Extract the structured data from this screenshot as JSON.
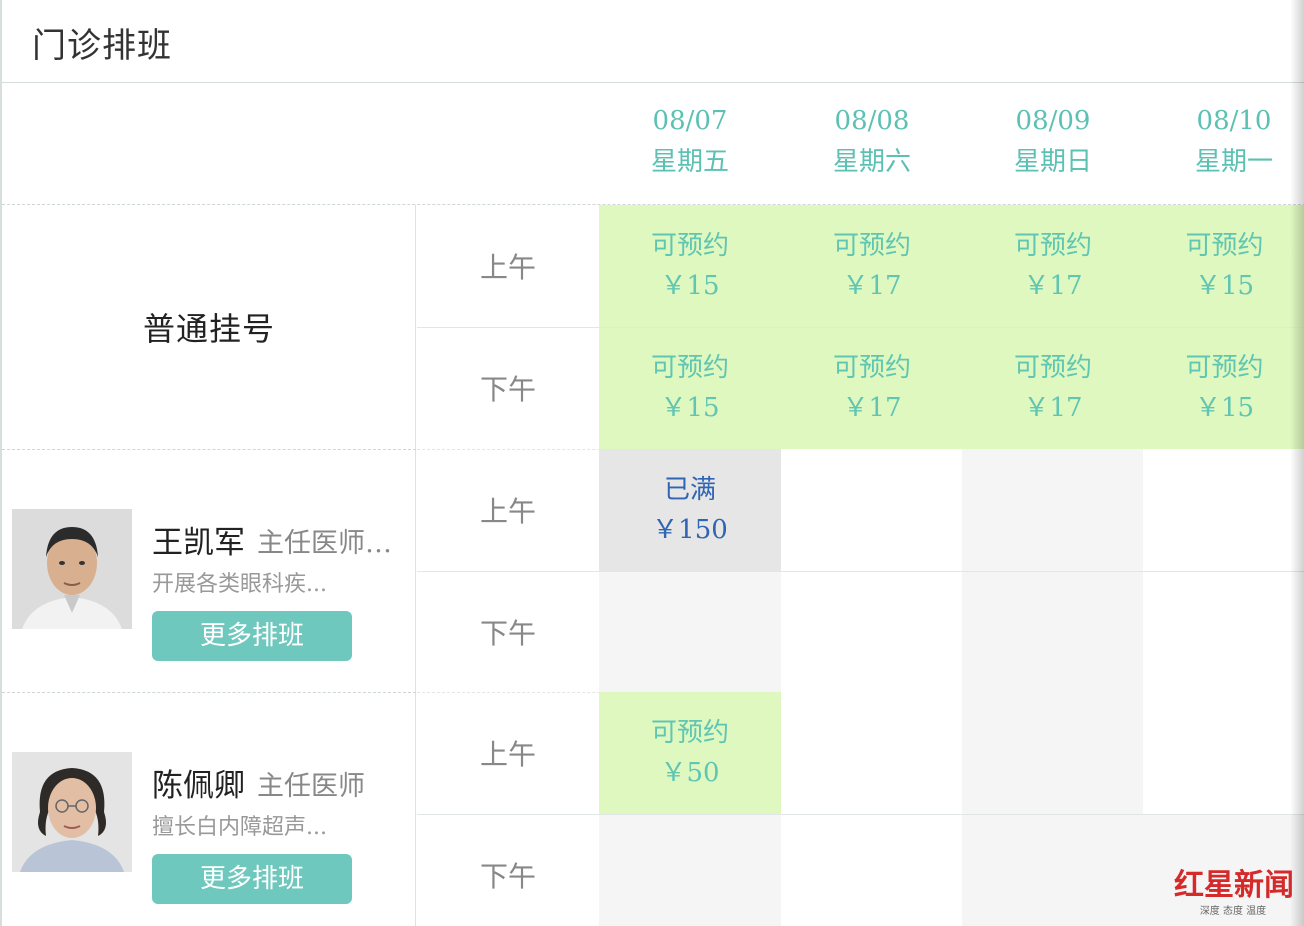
{
  "page": {
    "title": "门诊排班"
  },
  "dates": [
    {
      "date": "08/07",
      "weekday": "星期五"
    },
    {
      "date": "08/08",
      "weekday": "星期六"
    },
    {
      "date": "08/09",
      "weekday": "星期日"
    },
    {
      "date": "08/10",
      "weekday": "星期一"
    }
  ],
  "periods": {
    "am": "上午",
    "pm": "下午"
  },
  "general": {
    "label": "普通挂号",
    "am": [
      {
        "status": "可预约",
        "price": "￥15"
      },
      {
        "status": "可预约",
        "price": "￥17"
      },
      {
        "status": "可预约",
        "price": "￥17"
      },
      {
        "status": "可预约",
        "price": "￥15"
      }
    ],
    "pm": [
      {
        "status": "可预约",
        "price": "￥15"
      },
      {
        "status": "可预约",
        "price": "￥17"
      },
      {
        "status": "可预约",
        "price": "￥17"
      },
      {
        "status": "可预约",
        "price": "￥15"
      }
    ]
  },
  "doctors": [
    {
      "name": "王凯军",
      "title": "主任医师…",
      "desc": "开展各类眼科疾...",
      "button": "更多排班",
      "am": [
        {
          "status": "已满",
          "price": "￥150"
        }
      ]
    },
    {
      "name": "陈佩卿",
      "title": "主任医师",
      "desc": "擅长白内障超声...",
      "button": "更多排班",
      "am": [
        {
          "status": "可预约",
          "price": "￥50"
        }
      ]
    }
  ],
  "watermark": {
    "main": "红星新闻",
    "sub": "深度 态度 温度"
  },
  "colors": {
    "accent": "#5cc1b3",
    "available_bg": "#dff8c0",
    "full_bg": "#e6e6e6",
    "full_text": "#2f65b2",
    "button_bg": "#6fc8bd"
  }
}
